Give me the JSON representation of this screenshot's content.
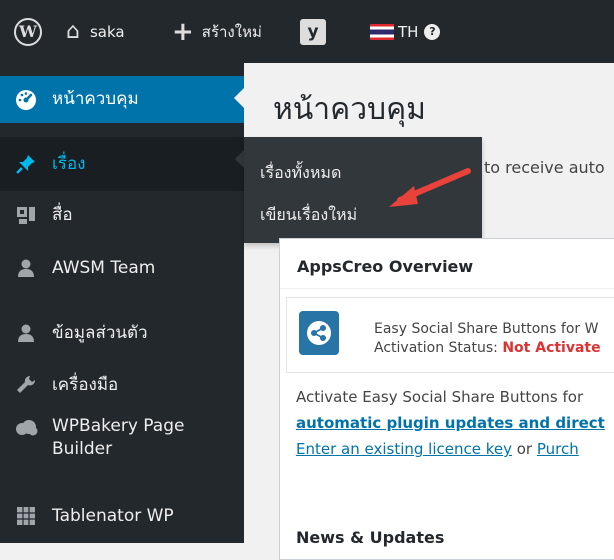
{
  "admin_bar": {
    "site_name": "saka",
    "new_label": "สร้างใหม่",
    "language": "TH",
    "help_glyph": "?"
  },
  "sidebar": {
    "items": [
      {
        "label": "หน้าควบคุม",
        "icon": "dashboard-icon",
        "state": "active"
      },
      {
        "label": "เรื่อง",
        "icon": "pin-icon",
        "state": "hovered"
      },
      {
        "label": "สื่อ",
        "icon": "media-icon",
        "state": "normal"
      },
      {
        "label": "AWSM Team",
        "icon": "user-icon",
        "state": "normal"
      },
      {
        "label": "ข้อมูลส่วนตัว",
        "icon": "user-icon",
        "state": "normal"
      },
      {
        "label": "เครื่องมือ",
        "icon": "wrench-icon",
        "state": "normal"
      },
      {
        "label": "WPBakery Page",
        "label2": "Builder",
        "icon": "cloud-icon",
        "state": "normal"
      },
      {
        "label": "Tablenator WP",
        "icon": "table-icon",
        "state": "normal"
      }
    ],
    "flyout": [
      {
        "label": "เรื่องทั้งหมด"
      },
      {
        "label": "เขียนเรื่องใหม่"
      }
    ]
  },
  "main": {
    "page_title": "หน้าควบคุม",
    "notice_text": "to receive auto",
    "panel": {
      "title": "AppsCreo Overview",
      "plugin_name": "Easy Social Share Buttons for W",
      "activation_label": "Activation Status:",
      "activation_status": "Not Activate",
      "desc_line1": "Activate Easy Social Share Buttons for",
      "desc_link1": "automatic plugin updates and direct",
      "desc_link2": "Enter an existing licence key",
      "desc_or": " or ",
      "desc_link3": "Purch",
      "news_title": "News & Updates"
    }
  },
  "colors": {
    "admin_bar": "#23282d",
    "active": "#0073aa",
    "hover_text": "#00b9eb",
    "arrow": "#e8423a",
    "status_red": "#dc3232"
  }
}
